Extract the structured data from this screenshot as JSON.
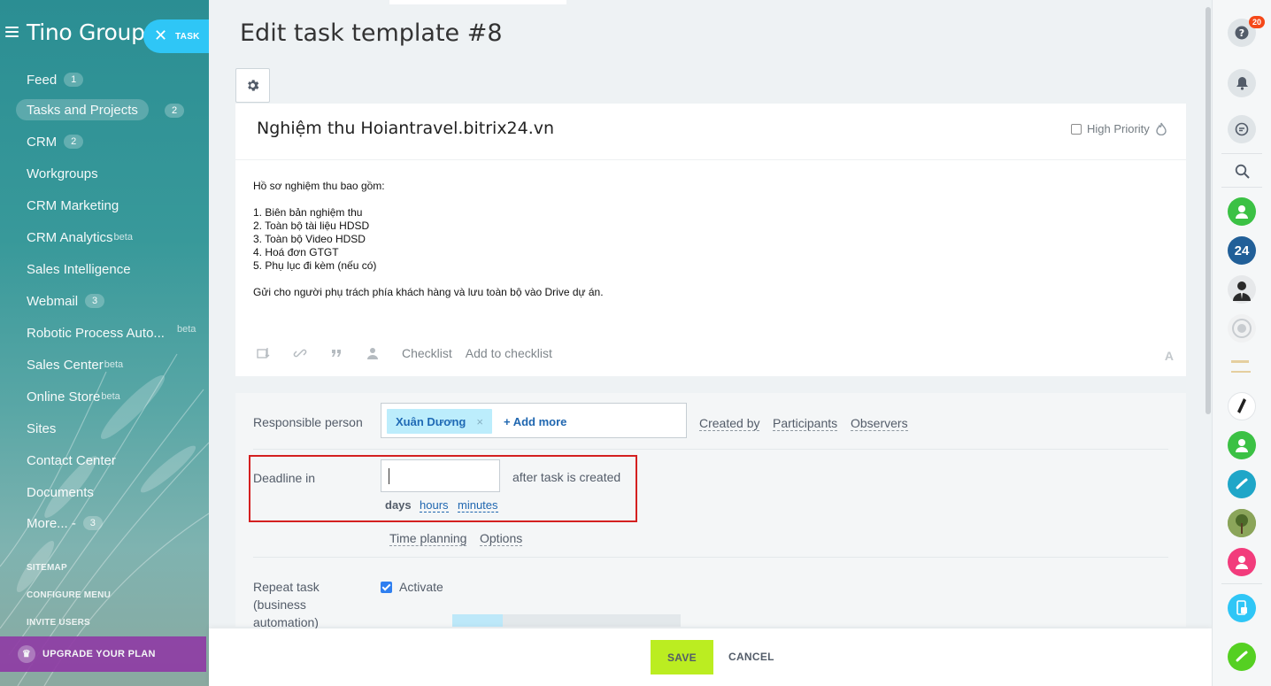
{
  "sidebar": {
    "brand": "Tino Group",
    "task_button": "TASK",
    "items": [
      {
        "label": "Feed",
        "counter": "1"
      },
      {
        "label": "Tasks and Projects",
        "counter": "2"
      },
      {
        "label": "CRM",
        "counter": "2"
      },
      {
        "label": "Workgroups"
      },
      {
        "label": "CRM Marketing"
      },
      {
        "label": "CRM Analytics",
        "beta": "beta"
      },
      {
        "label": "Sales Intelligence"
      },
      {
        "label": "Webmail",
        "counter": "3"
      },
      {
        "label": "Robotic Process Auto...",
        "beta": "beta"
      },
      {
        "label": "Sales Center",
        "beta": "beta"
      },
      {
        "label": "Online Store",
        "beta": "beta"
      },
      {
        "label": "Sites"
      },
      {
        "label": "Contact Center"
      },
      {
        "label": "Documents"
      },
      {
        "label": "More... -",
        "counter": "3"
      }
    ],
    "sitemap": "SITEMAP",
    "configure_menu": "CONFIGURE MENU",
    "invite_users": "INVITE USERS",
    "upgrade": "UPGRADE YOUR PLAN"
  },
  "page": {
    "title": "Edit task template #8"
  },
  "task": {
    "name": "Nghiệm thu Hoiantravel.bitrix24.vn",
    "high_priority": "High Priority",
    "description": [
      "Hồ sơ nghiệm thu bao gồm:",
      "",
      "1. Biên bản nghiệm thu",
      "2. Toàn bộ tài liệu HDSD",
      "3. Toàn bộ Video HDSD",
      "4. Hoá đơn GTGT",
      "5. Phụ lục đi kèm (nếu có)",
      "",
      "Gửi cho người phụ trách phía khách hàng và lưu toàn bộ vào Drive dự án."
    ],
    "checklist": "Checklist",
    "add_to_checklist": "Add to checklist",
    "font_toggle": "A"
  },
  "form": {
    "responsible_label": "Responsible person",
    "responsible_person": "Xuân Dương",
    "remove_mark": "×",
    "add_more": "+ Add more",
    "created_by": "Created by",
    "participants": "Participants",
    "observers": "Observers",
    "deadline_label": "Deadline in",
    "deadline_value": "",
    "after_created": "after task is created",
    "unit_days": "days",
    "unit_hours": "hours",
    "unit_minutes": "minutes",
    "time_planning": "Time planning",
    "options": "Options",
    "repeat_label_1": "Repeat task",
    "repeat_label_2": "(business",
    "repeat_label_3": "automation)",
    "activate": "Activate"
  },
  "footer": {
    "save": "SAVE",
    "cancel": "CANCEL"
  },
  "rightbar": {
    "help_badge": "20",
    "company_avatar_text": "24"
  },
  "colors": {
    "accent_blue": "#2fc6f6",
    "save_green": "#bbed21",
    "highlight_red": "#d42020",
    "tag_bg": "#bcedfc",
    "link_blue": "#2067b0"
  }
}
